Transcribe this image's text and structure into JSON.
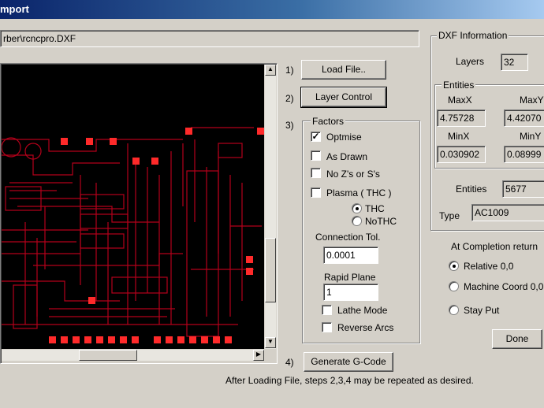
{
  "window": {
    "title": "mport"
  },
  "file_path": "rber\\rcncpro.DXF",
  "steps": {
    "s1": "1)",
    "s2": "2)",
    "s3": "3)",
    "s4": "4)",
    "load_file": "Load File..",
    "layer_control": "Layer Control",
    "generate_gcode": "Generate G-Code",
    "hint": "After Loading File, steps 2,3,4 may be repeated as desired."
  },
  "factors": {
    "legend": "Factors",
    "optimise": {
      "label": "Optmise",
      "checked": true
    },
    "as_drawn": {
      "label": "As Drawn",
      "checked": false
    },
    "no_z": {
      "label": "No Z's or S's",
      "checked": false
    },
    "plasma": {
      "label": "Plasma ( THC )",
      "checked": false
    },
    "thc": {
      "label": "THC",
      "selected": true
    },
    "nothc": {
      "label": "NoTHC",
      "selected": false
    },
    "connection_tol_label": "Connection Tol.",
    "connection_tol_value": "0.0001",
    "rapid_plane_label": "Rapid Plane",
    "rapid_plane_value": "1",
    "lathe_mode": {
      "label": "Lathe Mode",
      "checked": false
    },
    "reverse_arcs": {
      "label": "Reverse Arcs",
      "checked": false
    }
  },
  "dxf_info": {
    "legend": "DXF Information",
    "layers_label": "Layers",
    "layers_value": "32",
    "entities_group": "Entities",
    "maxx_label": "MaxX",
    "maxx_value": "4.75728",
    "maxy_label": "MaxY",
    "maxy_value": "4.42070",
    "minx_label": "MinX",
    "minx_value": "0.030902",
    "miny_label": "MinY",
    "miny_value": "0.08999",
    "entities_label": "Entities",
    "entities_value": "5677",
    "type_label": "Type",
    "type_value": "AC1009"
  },
  "completion": {
    "label": "At Completion return",
    "relative": {
      "label": "Relative 0,0",
      "selected": true
    },
    "machine": {
      "label": "Machine Coord 0,0",
      "selected": false
    },
    "stay": {
      "label": "Stay Put",
      "selected": false
    }
  },
  "done_button": "Done",
  "colors": {
    "titlebar": "#0a246a",
    "trace": "#b4001a",
    "pad": "#ff2a2a"
  }
}
